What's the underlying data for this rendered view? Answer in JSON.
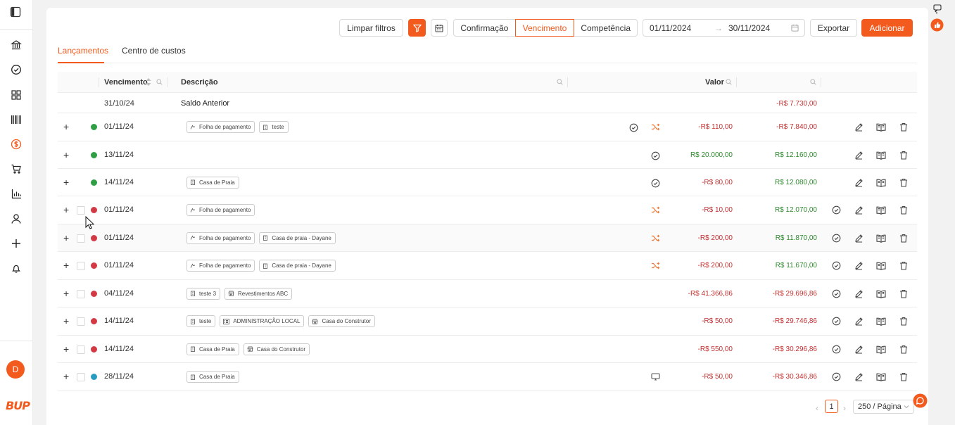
{
  "toolbar": {
    "clear_filters": "Limpar filtros",
    "date_modes": [
      "Confirmação",
      "Vencimento",
      "Competência"
    ],
    "date_start": "01/11/2024",
    "date_end": "30/11/2024",
    "export": "Exportar",
    "add": "Adicionar"
  },
  "tabs": [
    "Lançamentos",
    "Centro de custos"
  ],
  "table": {
    "headers": {
      "due": "Vencimento",
      "description": "Descrição",
      "value": "Valor"
    },
    "opening": {
      "date": "31/10/24",
      "label": "Saldo Anterior",
      "balance": "-R$ 7.730,00"
    },
    "rows": [
      {
        "date": "01/11/24",
        "status": "green",
        "tags": [
          {
            "icon": "payroll",
            "text": "Folha de pagamento"
          },
          {
            "icon": "building",
            "text": "teste"
          }
        ],
        "value": "-R$ 110,00",
        "balance": "-R$ 7.840,00",
        "value_pos": false,
        "balance_pos": false
      },
      {
        "date": "13/11/24",
        "status": "green",
        "tags": [],
        "value": "R$ 20.000,00",
        "balance": "R$ 12.160,00",
        "value_pos": true,
        "balance_pos": true
      },
      {
        "date": "14/11/24",
        "status": "green",
        "tags": [
          {
            "icon": "building",
            "text": "Casa de Praia"
          }
        ],
        "value": "-R$ 80,00",
        "balance": "R$ 12.080,00",
        "value_pos": false,
        "balance_pos": true
      },
      {
        "date": "01/11/24",
        "status": "red",
        "tags": [
          {
            "icon": "payroll",
            "text": "Folha de pagamento"
          }
        ],
        "value": "-R$ 10,00",
        "balance": "R$ 12.070,00",
        "value_pos": false,
        "balance_pos": true
      },
      {
        "date": "01/11/24",
        "status": "red",
        "tags": [
          {
            "icon": "payroll",
            "text": "Folha de pagamento"
          },
          {
            "icon": "building",
            "text": "Casa de praia - Dayane"
          }
        ],
        "value": "-R$ 200,00",
        "balance": "R$ 11.870,00",
        "value_pos": false,
        "balance_pos": true
      },
      {
        "date": "01/11/24",
        "status": "red",
        "tags": [
          {
            "icon": "payroll",
            "text": "Folha de pagamento"
          },
          {
            "icon": "building",
            "text": "Casa de praia - Dayane"
          }
        ],
        "value": "-R$ 200,00",
        "balance": "R$ 11.670,00",
        "value_pos": false,
        "balance_pos": true
      },
      {
        "date": "04/11/24",
        "status": "red",
        "tags": [
          {
            "icon": "building",
            "text": "teste 3"
          },
          {
            "icon": "store",
            "text": "Revestimentos ABC"
          }
        ],
        "value": "-R$ 41.366,86",
        "balance": "-R$ 29.696,86",
        "value_pos": false,
        "balance_pos": false
      },
      {
        "date": "14/11/24",
        "status": "red",
        "tags": [
          {
            "icon": "building",
            "text": "teste"
          },
          {
            "icon": "list",
            "text": "ADMINISTRAÇÃO LOCAL"
          },
          {
            "icon": "store",
            "text": "Casa do Construtor"
          }
        ],
        "value": "-R$ 50,00",
        "balance": "-R$ 29.746,86",
        "value_pos": false,
        "balance_pos": false
      },
      {
        "date": "14/11/24",
        "status": "red",
        "tags": [
          {
            "icon": "building",
            "text": "Casa de Praia"
          },
          {
            "icon": "store",
            "text": "Casa do Construtor"
          }
        ],
        "value": "-R$ 550,00",
        "balance": "-R$ 30.296,86",
        "value_pos": false,
        "balance_pos": false
      },
      {
        "date": "28/11/24",
        "status": "blue",
        "tags": [
          {
            "icon": "building",
            "text": "Casa de Praia"
          }
        ],
        "value": "-R$ 50,00",
        "balance": "-R$ 30.346,86",
        "value_pos": false,
        "balance_pos": false
      }
    ]
  },
  "pagination": {
    "page": "1",
    "page_size": "250 / Página"
  },
  "user": {
    "initial": "D"
  },
  "brand": {
    "logo": "BUP",
    "accent": "#f25a1e"
  },
  "colors": {
    "green": "#2f9e44",
    "red": "#d13a45",
    "blue": "#2a9bc0",
    "negative": "#c53030",
    "positive": "#2f8a2f"
  }
}
